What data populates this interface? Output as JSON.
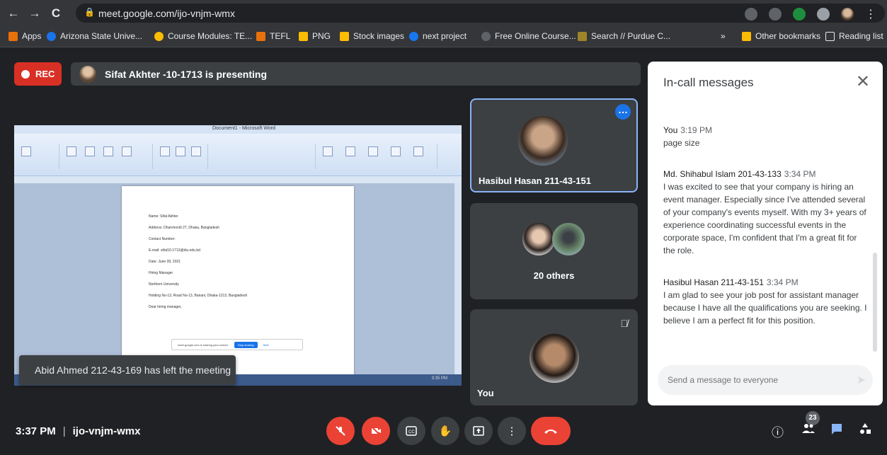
{
  "browser": {
    "url": "meet.google.com/ijo-vnjm-wmx",
    "nav": {
      "back": "←",
      "forward": "→",
      "reload": "C"
    },
    "bookmarks": [
      {
        "label": "Apps",
        "color": "#e8710a"
      },
      {
        "label": "Arizona State Unive...",
        "color": "#1a73e8"
      },
      {
        "label": "Course Modules: TE...",
        "color": "#fbbc04"
      },
      {
        "label": "TEFL",
        "color": "#e8710a"
      },
      {
        "label": "PNG",
        "color": "#fbbc04"
      },
      {
        "label": "Stock images",
        "color": "#fbbc04"
      },
      {
        "label": "next project",
        "color": "#1877f2"
      },
      {
        "label": "Free Online Course...",
        "color": "#5f6368"
      },
      {
        "label": "Search // Purdue C...",
        "color": "#a0842a"
      }
    ],
    "bookmarks_overflow": "»",
    "other_bookmarks": "Other bookmarks",
    "reading_list": "Reading list"
  },
  "meeting": {
    "rec_label": "REC",
    "presenting_text": "Sifat Akhter -10-1713 is presenting",
    "time": "3:37 PM",
    "separator": "|",
    "code": "ijo-vnjm-wmx",
    "toast": "Abid Ahmed 212-43-169 has left the meeting",
    "participants_count": "23"
  },
  "presentation": {
    "window_title": "Document1 - Microsoft Word",
    "doc_lines": [
      "Name: Sifat Akhter",
      "Address: Dhanmondi 27, Dhaka, Bangladesh",
      "Contact Number:",
      "E-mail: sifat10-1713@diu.edu.bd",
      "Date: June 09, 2021",
      "Hiring Manager",
      "Northern University",
      "Holding No-13, Road No-13, Banani, Dhaka-1213, Bangladesh",
      "Dear hiring manager,"
    ],
    "share_notice": "meet.google.com is sharing your screen.",
    "stop_sharing": "Stop sharing",
    "hide": "Hide",
    "taskbar_time": "3:35 PM"
  },
  "tiles": [
    {
      "name": "Hasibul Hasan 211-43-151"
    },
    {
      "name": "20 others"
    },
    {
      "name": "You"
    }
  ],
  "chat": {
    "title": "In-call messages",
    "close": "✕",
    "messages": [
      {
        "sender": "You",
        "time": "3:19 PM",
        "text": "page size"
      },
      {
        "sender": "Md. Shihabul Islam 201-43-133",
        "time": "3:34 PM",
        "text": "I was excited to see that your company is hiring an event manager. Especially since I've attended several of your company's events myself. With my 3+ years of experience coordinating successful events in the corporate space, I'm confident that I'm a great fit for the role."
      },
      {
        "sender": "Hasibul Hasan 211-43-151",
        "time": "3:34 PM",
        "text": "I am glad to see your job post for assistant manager because I have all the qualifications you are seeking. I believe I am a perfect fit for this position."
      }
    ],
    "input_placeholder": "Send a message to everyone"
  },
  "colors": {
    "background": "#202124",
    "rec_red": "#d93025",
    "end_call_red": "#ea4335",
    "accent_blue": "#1a73e8",
    "highlight_border": "#8ab4f8"
  },
  "icons": {
    "controls": [
      "mic-off-icon",
      "camera-off-icon",
      "captions-icon",
      "raise-hand-icon",
      "present-icon",
      "more-options-icon",
      "end-call-icon"
    ],
    "right": [
      "info-icon",
      "people-icon",
      "chat-icon",
      "activities-icon"
    ]
  }
}
